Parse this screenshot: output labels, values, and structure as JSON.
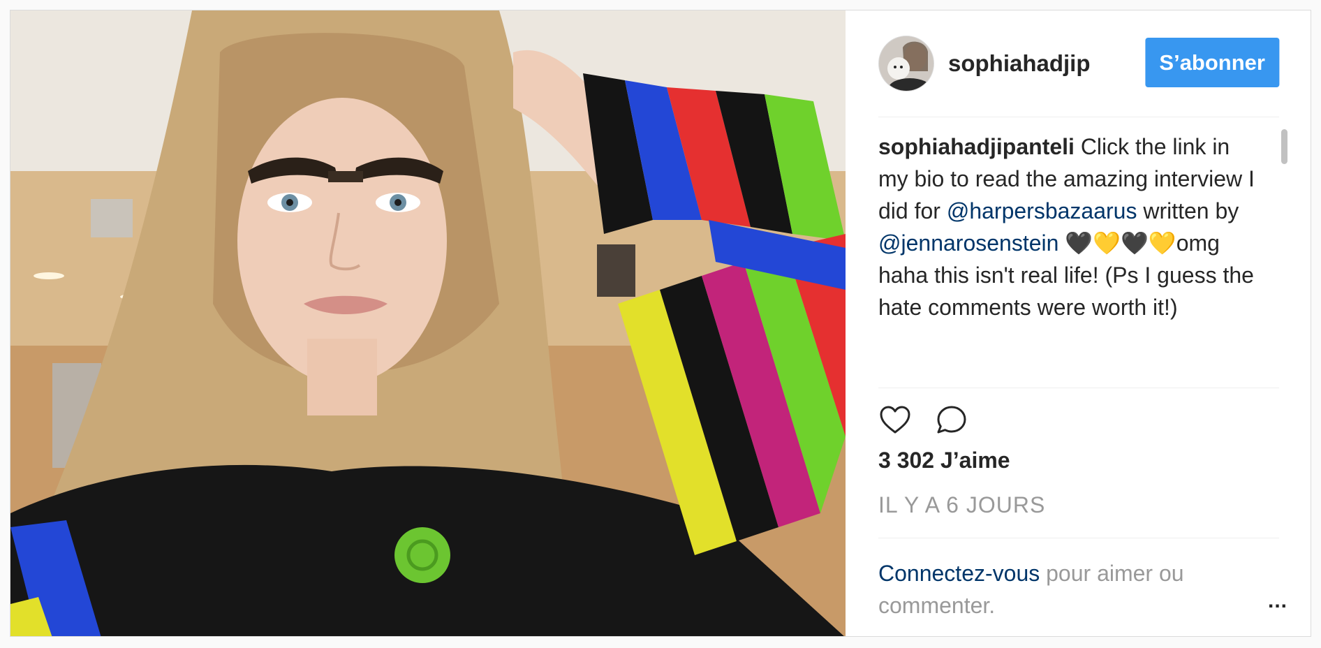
{
  "post": {
    "username": "sophiahadjip",
    "follow_label": "S’abonner",
    "caption": {
      "author": "sophiahadjipanteli",
      "text_1": " Click the link in my bio to read the amazing interview I did for ",
      "mention_1": "@harpersbazaarus",
      "text_2": " written by ",
      "mention_2": "@jennarosenstein",
      "text_3": " 🖤💛🖤💛omg haha this isn't real life! (Ps I guess the hate comments were worth it!)"
    },
    "likes": "3 302 J’aime",
    "timestamp": "IL Y A 6 JOURS",
    "login_link": "Connectez-vous",
    "login_rest": " pour aimer ou commenter.",
    "more_label": "..."
  },
  "icons": {
    "like": "heart-outline-icon",
    "comment": "speech-bubble-icon",
    "more": "ellipsis-icon"
  },
  "colors": {
    "follow_button": "#3897f0",
    "mention": "#003569",
    "muted_text": "#999999",
    "text": "#262626",
    "border": "#dbdbdb"
  }
}
